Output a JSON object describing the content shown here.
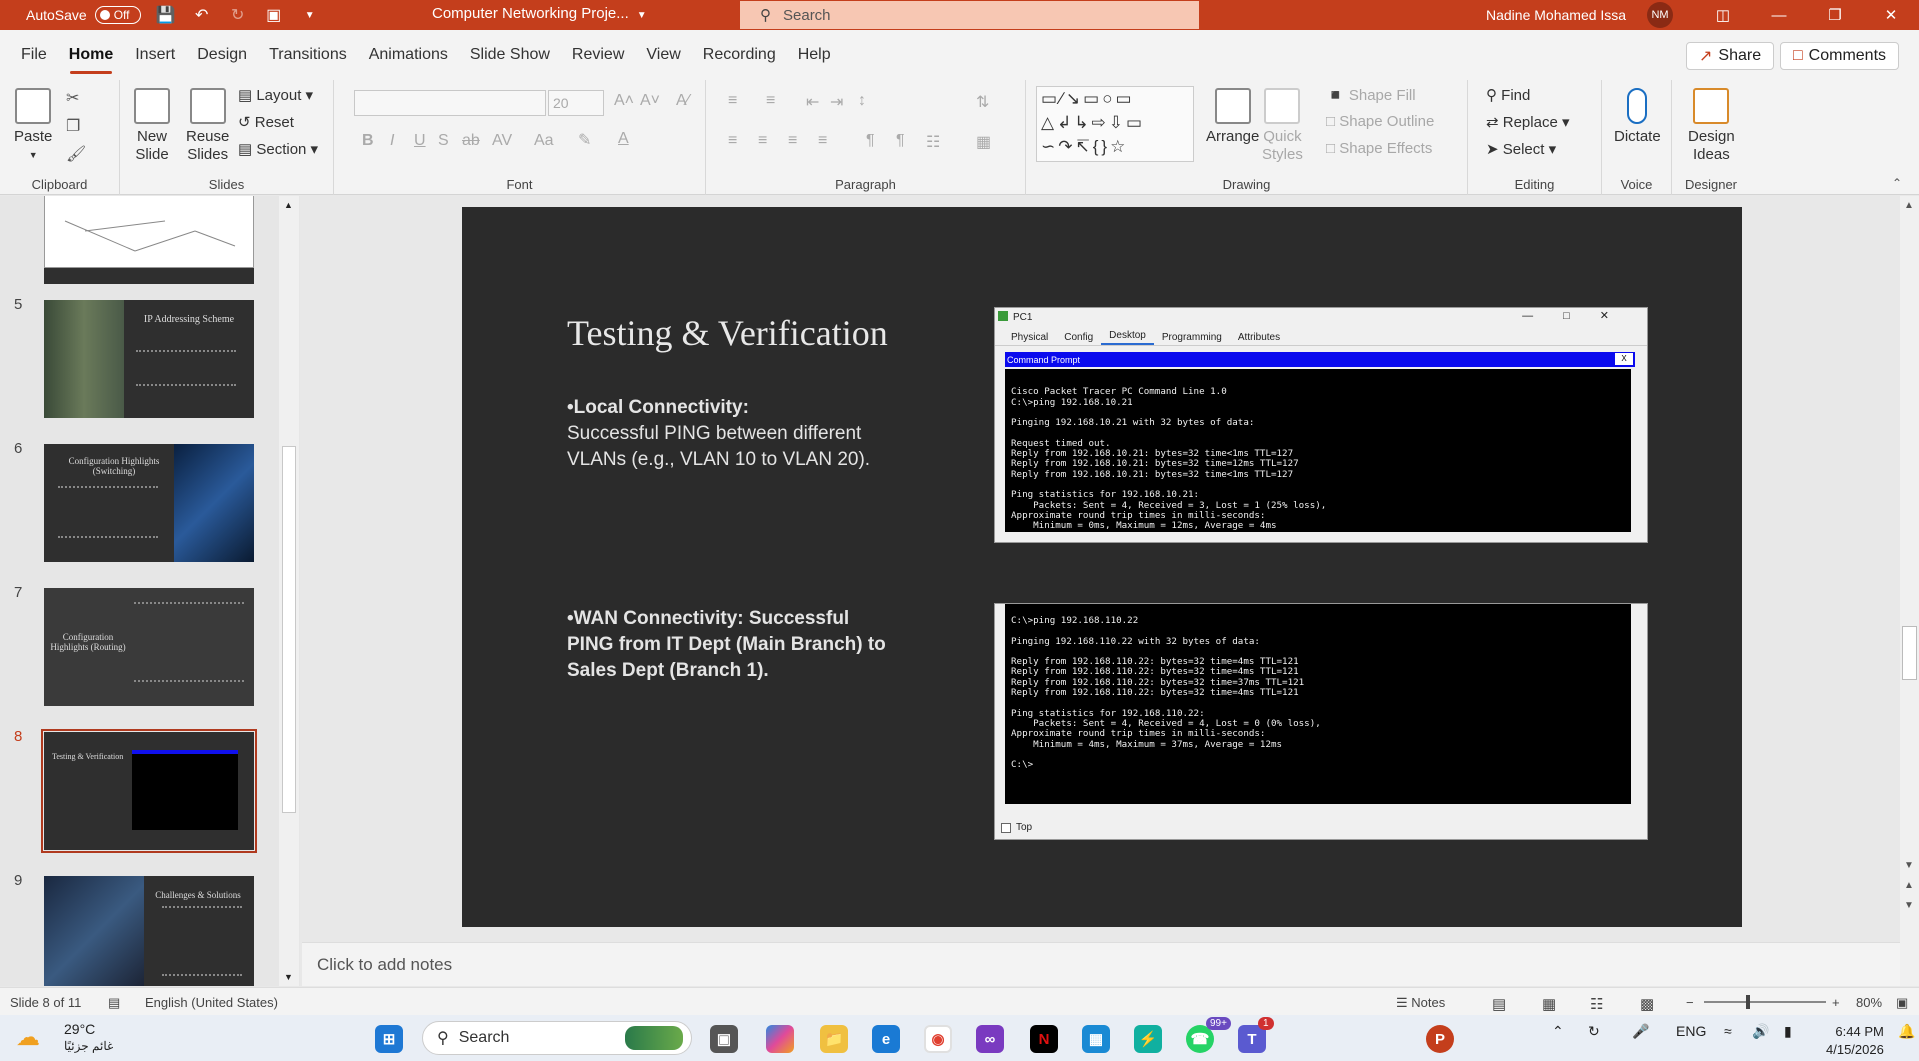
{
  "titlebar": {
    "autosave_label": "AutoSave",
    "autosave_state": "Off",
    "doc_title": "Computer Networking Proje...",
    "search_placeholder": "Search",
    "user_name": "Nadine Mohamed Issa",
    "user_initials": "NM"
  },
  "menu": {
    "tabs": [
      "File",
      "Home",
      "Insert",
      "Design",
      "Transitions",
      "Animations",
      "Slide Show",
      "Review",
      "View",
      "Recording",
      "Help"
    ],
    "active": "Home",
    "share_label": "Share",
    "comments_label": "Comments"
  },
  "ribbon": {
    "clipboard": {
      "paste": "Paste",
      "label": "Clipboard"
    },
    "slides": {
      "new_slide_1": "New",
      "new_slide_2": "Slide",
      "reuse_1": "Reuse",
      "reuse_2": "Slides",
      "layout": "Layout",
      "reset": "Reset",
      "section": "Section",
      "label": "Slides"
    },
    "font": {
      "size": "20",
      "label": "Font"
    },
    "paragraph": {
      "label": "Paragraph"
    },
    "drawing": {
      "arrange": "Arrange",
      "quick_styles_1": "Quick",
      "quick_styles_2": "Styles",
      "shape_fill": "Shape Fill",
      "shape_outline": "Shape Outline",
      "shape_effects": "Shape Effects",
      "label": "Drawing"
    },
    "editing": {
      "find": "Find",
      "replace": "Replace",
      "select": "Select",
      "label": "Editing"
    },
    "voice": {
      "dictate": "Dictate",
      "label": "Voice"
    },
    "designer": {
      "design_ideas_1": "Design",
      "design_ideas_2": "Ideas",
      "label": "Designer"
    }
  },
  "thumbnails": [
    {
      "num": "5",
      "title": "IP Addressing Scheme"
    },
    {
      "num": "6",
      "title": "Configuration Highlights (Switching)"
    },
    {
      "num": "7",
      "title": "Configuration Highlights (Routing)"
    },
    {
      "num": "8",
      "title": "Testing & Verification"
    },
    {
      "num": "9",
      "title": "Challenges & Solutions"
    }
  ],
  "slide": {
    "title": "Testing & Verification",
    "bullet1_head": "•Local Connectivity:",
    "bullet1_body": "Successful PING between different VLANs (e.g., VLAN 10 to VLAN 20).",
    "bullet2": "•WAN Connectivity: Successful PING from IT Dept (Main Branch) to Sales Dept (Branch 1).",
    "pc_window": {
      "title": "PC1",
      "tabs": [
        "Physical",
        "Config",
        "Desktop",
        "Programming",
        "Attributes"
      ],
      "active_tab": "Desktop",
      "cmd_title": "Command Prompt",
      "close": "X",
      "console": "\nCisco Packet Tracer PC Command Line 1.0\nC:\\>ping 192.168.10.21\n\nPinging 192.168.10.21 with 32 bytes of data:\n\nRequest timed out.\nReply from 192.168.10.21: bytes=32 time<1ms TTL=127\nReply from 192.168.10.21: bytes=32 time=12ms TTL=127\nReply from 192.168.10.21: bytes=32 time<1ms TTL=127\n\nPing statistics for 192.168.10.21:\n    Packets: Sent = 4, Received = 3, Lost = 1 (25% loss),\nApproximate round trip times in milli-seconds:\n    Minimum = 0ms, Maximum = 12ms, Average = 4ms"
    },
    "console2": "C:\\>ping 192.168.110.22\n\nPinging 192.168.110.22 with 32 bytes of data:\n\nReply from 192.168.110.22: bytes=32 time=4ms TTL=121\nReply from 192.168.110.22: bytes=32 time=4ms TTL=121\nReply from 192.168.110.22: bytes=32 time=37ms TTL=121\nReply from 192.168.110.22: bytes=32 time=4ms TTL=121\n\nPing statistics for 192.168.110.22:\n    Packets: Sent = 4, Received = 4, Lost = 0 (0% loss),\nApproximate round trip times in milli-seconds:\n    Minimum = 4ms, Maximum = 37ms, Average = 12ms\n\nC:\\>",
    "top_checkbox": "Top"
  },
  "notes_placeholder": "Click to add notes",
  "statusbar": {
    "slide_info": "Slide 8 of 11",
    "language": "English (United States)",
    "notes": "Notes",
    "zoom": "80%"
  },
  "taskbar": {
    "temp": "29°C",
    "weather_text": "غائم جزئيًا",
    "search": "Search",
    "lang": "ENG",
    "time": "6:44 PM",
    "date": "4/15/2026",
    "whatsapp_badge": "99+",
    "teams_badge": "1"
  }
}
